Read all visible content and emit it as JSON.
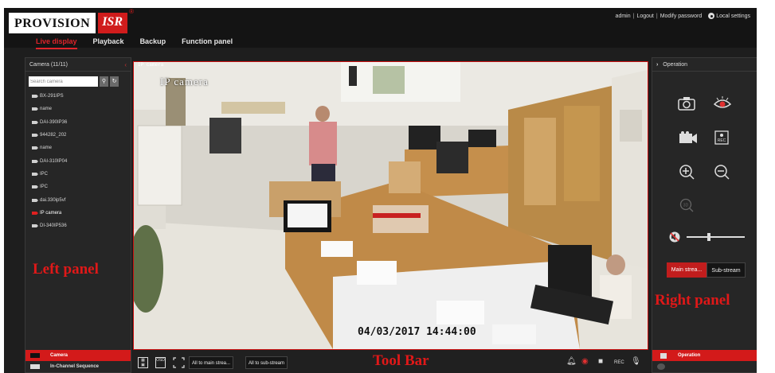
{
  "header": {
    "logo_brand": "PROVISION",
    "logo_isr": "ISR",
    "logo_reg": "®",
    "nav": [
      {
        "label": "Live display",
        "active": true
      },
      {
        "label": "Playback",
        "active": false
      },
      {
        "label": "Backup",
        "active": false
      },
      {
        "label": "Function panel",
        "active": false
      }
    ],
    "user": "admin",
    "logout": "Logout",
    "modify_password": "Modify password",
    "local_settings": "Local settings"
  },
  "left_panel": {
    "title": "Camera (11/11)",
    "search_placeholder": "Search camera",
    "cameras": [
      {
        "name": "BX-291IPS",
        "active": false
      },
      {
        "name": "name",
        "active": false
      },
      {
        "name": "DAI-390IP36",
        "active": false
      },
      {
        "name": "944282_202",
        "active": false
      },
      {
        "name": "name",
        "active": false
      },
      {
        "name": "DAI-310IP04",
        "active": false
      },
      {
        "name": "IPC",
        "active": false
      },
      {
        "name": "IPC",
        "active": false
      },
      {
        "name": "dai.330ip5vf",
        "active": false
      },
      {
        "name": "IP camera",
        "active": true
      },
      {
        "name": "DI-340IP536",
        "active": false
      }
    ],
    "annotation": "Left panel",
    "tabs": {
      "camera": "Camera",
      "sequence": "In-Channel Sequence"
    }
  },
  "video": {
    "osd_title_small": "IP camera",
    "osd_title": "IP camera",
    "osd_time": "04/03/2017 14:44:00"
  },
  "toolbar": {
    "all_main_stream": "All to main strea...",
    "all_sub_stream": "All to sub-stream",
    "annotation": "Tool Bar",
    "osd_icon_label": "OSD"
  },
  "right_panel": {
    "title": "Operation",
    "main_stream": "Main strea...",
    "sub_stream": "Sub-stream",
    "annotation": "Right panel",
    "tab_operation": "Operation",
    "volume_level": 0.38
  },
  "colors": {
    "accent_red": "#d31a1a",
    "background": "#1e1e1e",
    "panel": "#262626"
  }
}
